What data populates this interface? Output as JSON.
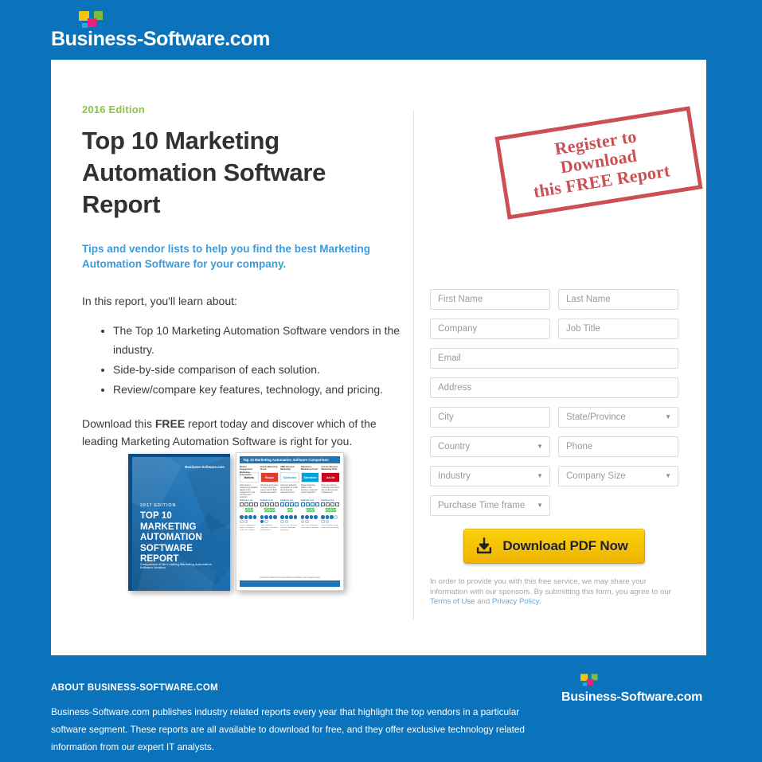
{
  "brand": {
    "name": "Business-Software.com",
    "blue": "#0B73BC",
    "green": "#8CC540",
    "accent_blue": "#3C9BDC",
    "button_yellow": "#FBD10B",
    "stamp_red": "#C0282D",
    "squares": [
      "#F6C40B",
      "#7DBB42",
      "#E6217E",
      "#29ABE2"
    ]
  },
  "hero": {
    "eyebrow": "2016 Edition",
    "title": "Top 10 Marketing Automation Software Report",
    "subtitle": "Tips and vendor lists to help you find the best Marketing Automation Software for your company.",
    "lead": "In this report, you'll learn about:",
    "bullets": [
      "The Top 10 Marketing Automation Software vendors in the industry.",
      "Side-by-side comparison of each solution.",
      "Review/compare key features, technology, and pricing."
    ],
    "closing_before": "Download this ",
    "closing_strong": "FREE",
    "closing_after": " report today and discover which of the leading Marketing Automation Software is right for you."
  },
  "covers": {
    "book": {
      "logo": "Business-Software.com",
      "edition": "2017 EDITION",
      "title": "TOP 10 MARKETING AUTOMATION SOFTWARE REPORT",
      "subtitle": "Comparison of the Leading Marketing Automation Software Vendors"
    },
    "chart": {
      "title": "Top 10 Marketing Automation Software Comparison",
      "columns": [
        {
          "category": "Market Engagement Marketing Automation",
          "vendor": "Marketo",
          "desc": "Cloud based marketing automation platform with engagement, lead nurturing and analytics.",
          "label": "Features List",
          "price": "$$$",
          "note": "Robust engagement engine, enterprise scale, rich analytics.",
          "filled": 4,
          "total": 6
        },
        {
          "category": "Oracle Marketing Cloud",
          "vendor": "Eloqua",
          "desc": "Marketing automation for large enterprise teams, built for B2B demand generation.",
          "label": "Features List",
          "price": "$$$$",
          "note": "Deep enterprise integrations, advanced segmentation.",
          "filled": 5,
          "total": 6
        },
        {
          "category": "SMB Inbound Marketing",
          "vendor": "Spotonline",
          "desc": "Inbound marketing automation for small and mid-sized marketing teams.",
          "label": "Features List",
          "price": "$$",
          "note": "Easy to use, inbound focused, affordable entry price.",
          "filled": 4,
          "total": 6
        },
        {
          "category": "Salesforce Marketing Cloud",
          "vendor": "Salesforce",
          "desc": "Digital marketing platform with journeys, email and social integration.",
          "label": "Features List",
          "price": "$$$",
          "note": "Tight CRM integration, cross-channel journeys.",
          "filled": 4,
          "total": 6
        },
        {
          "category": "Act-On Inbound Marketing Suite",
          "vendor": "Act-On",
          "desc": "All-in-one inbound marketing automation with email and lead management.",
          "label": "Features List",
          "price": "$$$$",
          "note": "Fast to deploy, strong email and lead scoring.",
          "filled": 3,
          "total": 6
        }
      ],
      "footer_note": "Comparison data from the latest Business-Software.com research report",
      "footer_logo": "Business-Software.com"
    }
  },
  "stamp": {
    "line1": "Register to Download",
    "line2": "this FREE Report"
  },
  "form": {
    "fields": [
      {
        "name": "first-name",
        "placeholder": "First Name",
        "type": "text",
        "width": "half"
      },
      {
        "name": "last-name",
        "placeholder": "Last Name",
        "type": "text",
        "width": "half"
      },
      {
        "name": "company",
        "placeholder": "Company",
        "type": "text",
        "width": "half"
      },
      {
        "name": "job-title",
        "placeholder": "Job Title",
        "type": "text",
        "width": "half"
      },
      {
        "name": "email",
        "placeholder": "Email",
        "type": "text",
        "width": "full"
      },
      {
        "name": "address",
        "placeholder": "Address",
        "type": "text",
        "width": "full"
      },
      {
        "name": "city",
        "placeholder": "City",
        "type": "text",
        "width": "half"
      },
      {
        "name": "state-province",
        "placeholder": "State/Province",
        "type": "select",
        "width": "half"
      },
      {
        "name": "country",
        "placeholder": "Country",
        "type": "select",
        "width": "half"
      },
      {
        "name": "phone",
        "placeholder": "Phone",
        "type": "text",
        "width": "half"
      },
      {
        "name": "industry",
        "placeholder": "Industry",
        "type": "select",
        "width": "half"
      },
      {
        "name": "company-size",
        "placeholder": "Company Size",
        "type": "select",
        "width": "half"
      },
      {
        "name": "purchase-time-frame",
        "placeholder": "Purchase Time frame",
        "type": "select",
        "width": "half"
      }
    ],
    "submit_label": "Download PDF Now",
    "submit_icon": "download-icon",
    "legal_text": "In order to provide you with this free service, we may share your information with our sponsors. By submitting this form, you agree to our ",
    "legal_link_1": "Terms of Use",
    "legal_middle": " and ",
    "legal_link_2": "Privacy Policy",
    "legal_end": "."
  },
  "footer": {
    "heading": "ABOUT BUSINESS-SOFTWARE.COM",
    "body": "Business-Software.com publishes industry related reports every year that highlight the top vendors in a particular software segment. These reports are all available to download for free, and they offer exclusive technology related information from our expert IT analysts.",
    "logo": "Business-Software.com"
  }
}
